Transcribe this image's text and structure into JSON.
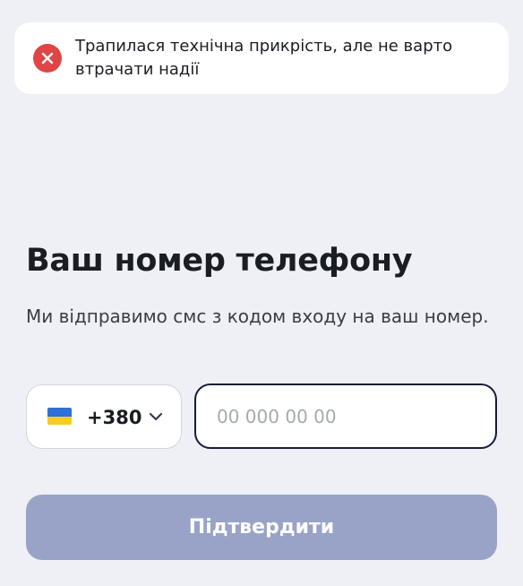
{
  "toast": {
    "icon": "error-icon",
    "icon_color": "#e04545",
    "message": "Трапилася технічна прикрість, але не варто втрачати надії"
  },
  "screen": {
    "title": "Ваш номер телефону",
    "subtitle": "Ми відправимо смс з кодом входу на ваш номер."
  },
  "phone": {
    "country_flag": "ukraine-flag-icon",
    "country_code": "+380",
    "dropdown_icon": "chevron-down-icon",
    "value": "",
    "placeholder": "00 000 00 00"
  },
  "actions": {
    "submit_label": "Підтвердити",
    "submit_color": "#98a3c7"
  }
}
